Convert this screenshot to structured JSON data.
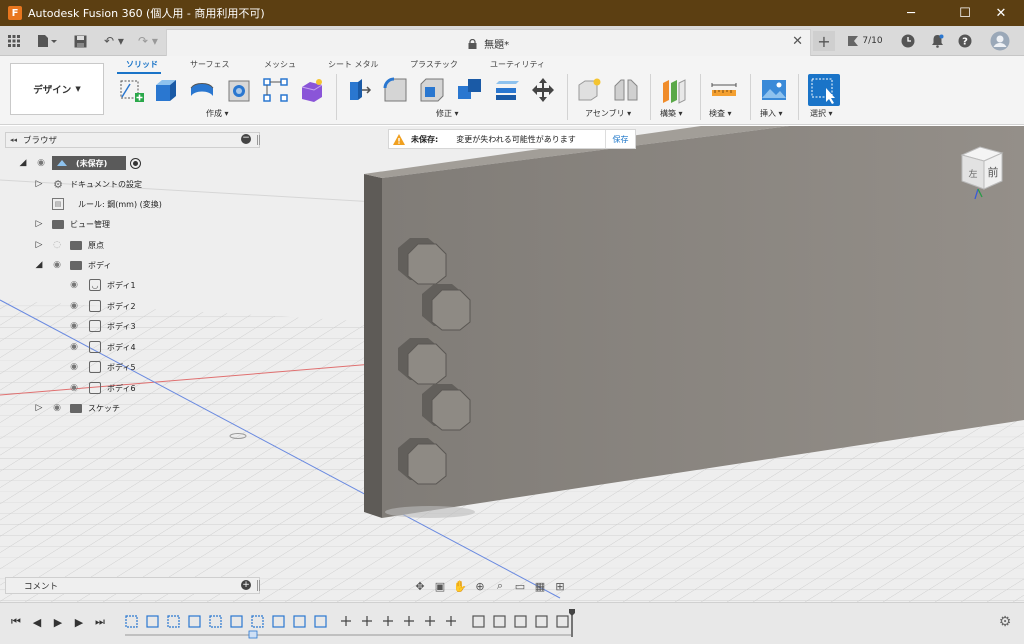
{
  "window": {
    "title": "Autodesk Fusion 360 (個人用 - 商用利用不可)",
    "app_icon": "F"
  },
  "quick_access": {
    "job_status": "7/10"
  },
  "document": {
    "title": "無題*"
  },
  "ribbon": {
    "workspace": "デザイン",
    "tabs": [
      "ソリッド",
      "サーフェス",
      "メッシュ",
      "シート メタル",
      "プラスチック",
      "ユーティリティ"
    ],
    "active_tab": "ソリッド",
    "groups": {
      "create": "作成",
      "modify": "修正",
      "assemble": "アセンブリ",
      "construct": "構築",
      "inspect": "検査",
      "insert": "挿入",
      "select": "選択"
    }
  },
  "browser": {
    "title": "ブラウザ",
    "root": "(未保存)",
    "items": [
      {
        "label": "ドキュメントの設定"
      },
      {
        "label": "ルール: 鋼(mm) (変換)"
      },
      {
        "label": "ビュー管理"
      },
      {
        "label": "原点"
      },
      {
        "label": "ボディ"
      },
      {
        "label": "ボディ1"
      },
      {
        "label": "ボディ2"
      },
      {
        "label": "ボディ3"
      },
      {
        "label": "ボディ4"
      },
      {
        "label": "ボディ5"
      },
      {
        "label": "ボディ6"
      },
      {
        "label": "スケッチ"
      }
    ]
  },
  "notification": {
    "label": "未保存:",
    "message": "変更が失われる可能性があります",
    "action": "保存"
  },
  "comments": {
    "label": "コメント"
  },
  "viewcube": {
    "front": "前",
    "left": "左"
  },
  "colors": {
    "titlebar": "#5c3f12",
    "accent": "#1a74c8",
    "viewport": "#eeeeee",
    "body": "#8a8680"
  }
}
